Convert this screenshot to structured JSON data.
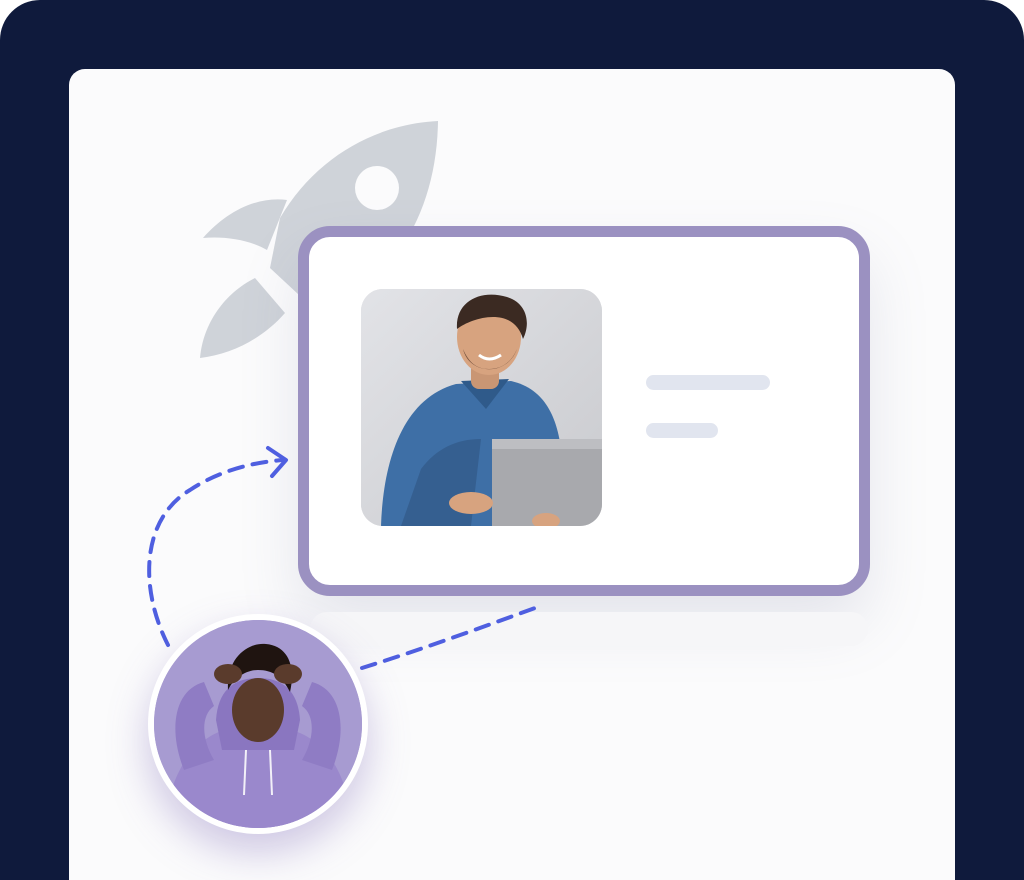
{
  "illustration": {
    "icons": {
      "rocket": "rocket-icon",
      "arrow": "dashed-arrow-icon"
    },
    "colors": {
      "frame": "#0f1a3c",
      "panel": "#fbfbfc",
      "card_border": "#9b91c1",
      "rocket": "#cfd3d9",
      "dash": "#4f5fe0",
      "text_placeholder": "#e1e5ef",
      "avatar_bg": "#a79bd1"
    },
    "photos": {
      "main": "man-with-laptop-photo",
      "avatar": "person-in-purple-hoodie-photo"
    }
  }
}
